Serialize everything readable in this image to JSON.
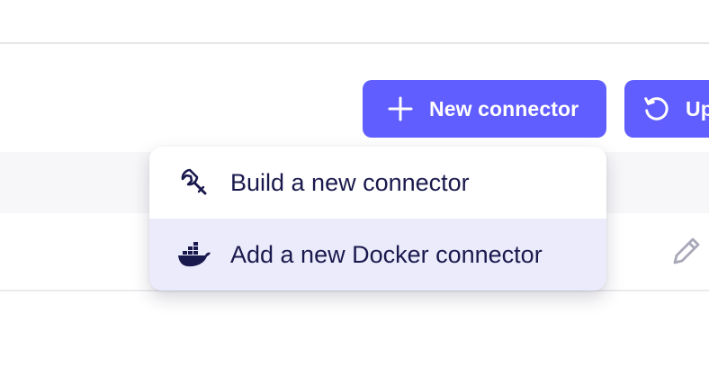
{
  "toolbar": {
    "new_connector_label": "New connector",
    "update_label": "Update"
  },
  "dropdown": {
    "items": [
      {
        "label": "Build a new connector",
        "icon": "wrench-icon"
      },
      {
        "label": "Add a new Docker connector",
        "icon": "docker-icon"
      }
    ]
  },
  "table": {
    "row_actions": {
      "edit_icon": "pencil-icon"
    }
  },
  "colors": {
    "accent": "#615eff",
    "menu_hover": "#ebebfb",
    "menu_text": "#1a194d",
    "icon_muted": "#a8a8b8"
  }
}
